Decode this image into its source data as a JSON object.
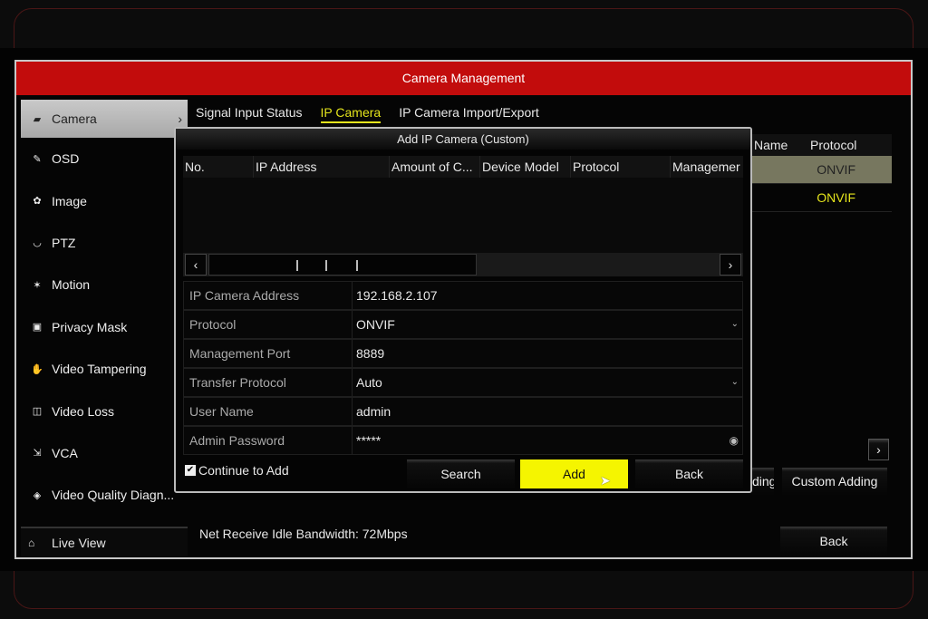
{
  "window": {
    "title": "Camera Management"
  },
  "sidebar": {
    "items": [
      {
        "label": "Camera",
        "icon": "camera-icon",
        "glyph": "▰",
        "selected": true
      },
      {
        "label": "OSD",
        "icon": "osd-icon",
        "glyph": "✎"
      },
      {
        "label": "Image",
        "icon": "image-icon",
        "glyph": "✿"
      },
      {
        "label": "PTZ",
        "icon": "ptz-icon",
        "glyph": "◡"
      },
      {
        "label": "Motion",
        "icon": "motion-icon",
        "glyph": "✶"
      },
      {
        "label": "Privacy Mask",
        "icon": "privacy-mask-icon",
        "glyph": "▣"
      },
      {
        "label": "Video Tampering",
        "icon": "hand-icon",
        "glyph": "✋"
      },
      {
        "label": "Video Loss",
        "icon": "video-loss-icon",
        "glyph": "◫"
      },
      {
        "label": "VCA",
        "icon": "vca-icon",
        "glyph": "⇲"
      },
      {
        "label": "Video Quality Diagn...",
        "icon": "diagnosis-icon",
        "glyph": "◈"
      }
    ],
    "live_view": "Live View"
  },
  "tabs": [
    "Signal Input Status",
    "IP Camera",
    "IP Camera Import/Export"
  ],
  "bg_table": {
    "headers": [
      "Name",
      "Protocol"
    ],
    "rows": [
      "ONVIF",
      "ONVIF"
    ]
  },
  "bg_buttons": {
    "partial": "ding",
    "custom_adding": "Custom Adding",
    "back": "Back"
  },
  "status": "Net Receive Idle Bandwidth: 72Mbps",
  "dialog": {
    "title": "Add IP Camera (Custom)",
    "columns": [
      "No.",
      "IP Address",
      "Amount of C...",
      "Device Model",
      "Protocol",
      "Managemer"
    ],
    "fields": [
      {
        "label": "IP Camera Address",
        "value": "192.168.2.107"
      },
      {
        "label": "Protocol",
        "value": "ONVIF",
        "dropdown": true
      },
      {
        "label": "Management Port",
        "value": "8889"
      },
      {
        "label": "Transfer Protocol",
        "value": "Auto",
        "dropdown": true
      },
      {
        "label": "User Name",
        "value": "admin"
      },
      {
        "label": "Admin Password",
        "value": "*****",
        "eye": true
      }
    ],
    "continue_to_add": "Continue to Add",
    "continue_checked": true,
    "search": "Search",
    "add": "Add",
    "back": "Back"
  },
  "colors": {
    "header": "#c20c0c",
    "accent": "#e4e41c",
    "add_button": "#f5f500"
  }
}
